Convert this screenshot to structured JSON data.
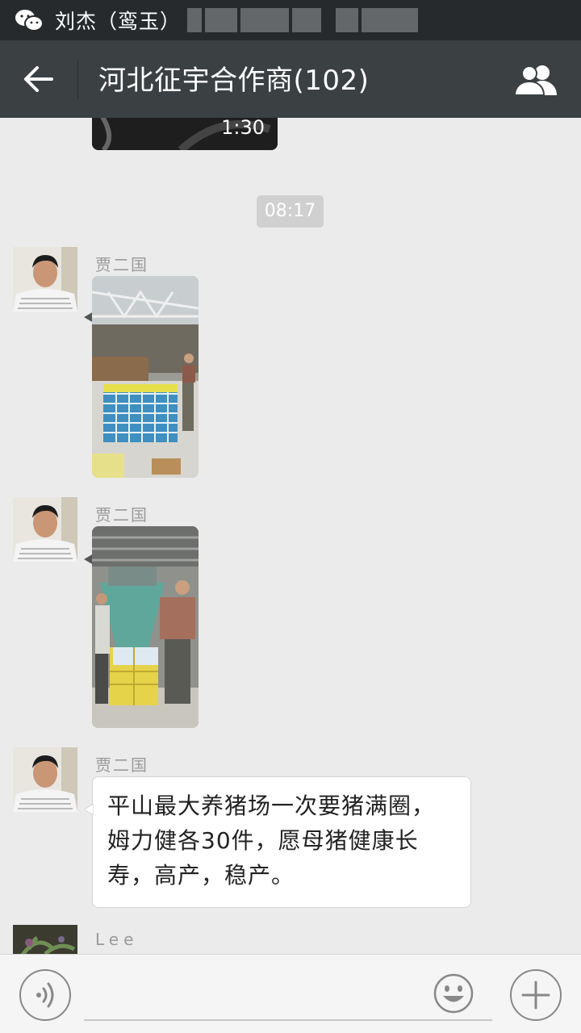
{
  "status_bar": {
    "app_icon": "wechat-icon",
    "title": "刘杰（鸾玉）"
  },
  "header": {
    "back_icon": "arrow-left-icon",
    "title": "河北征宇合作商(102)",
    "members_icon": "group-icon"
  },
  "chat": {
    "video": {
      "duration": "1:30"
    },
    "timestamp": "08:17",
    "messages": [
      {
        "sender": "贾二国",
        "type": "image",
        "image": "warehouse-boxes-photo"
      },
      {
        "sender": "贾二国",
        "type": "image",
        "image": "farm-men-boxes-photo"
      },
      {
        "sender": "贾二国",
        "type": "text",
        "text": "平山最大养猪场一次要猪满圈，姆力健各30件，愿母猪健康长寿，高产，稳产。"
      },
      {
        "sender": "Lee",
        "type": "partial"
      }
    ]
  },
  "input_bar": {
    "voice_icon": "voice-icon",
    "emoji_icon": "emoji-icon",
    "plus_icon": "plus-icon"
  }
}
